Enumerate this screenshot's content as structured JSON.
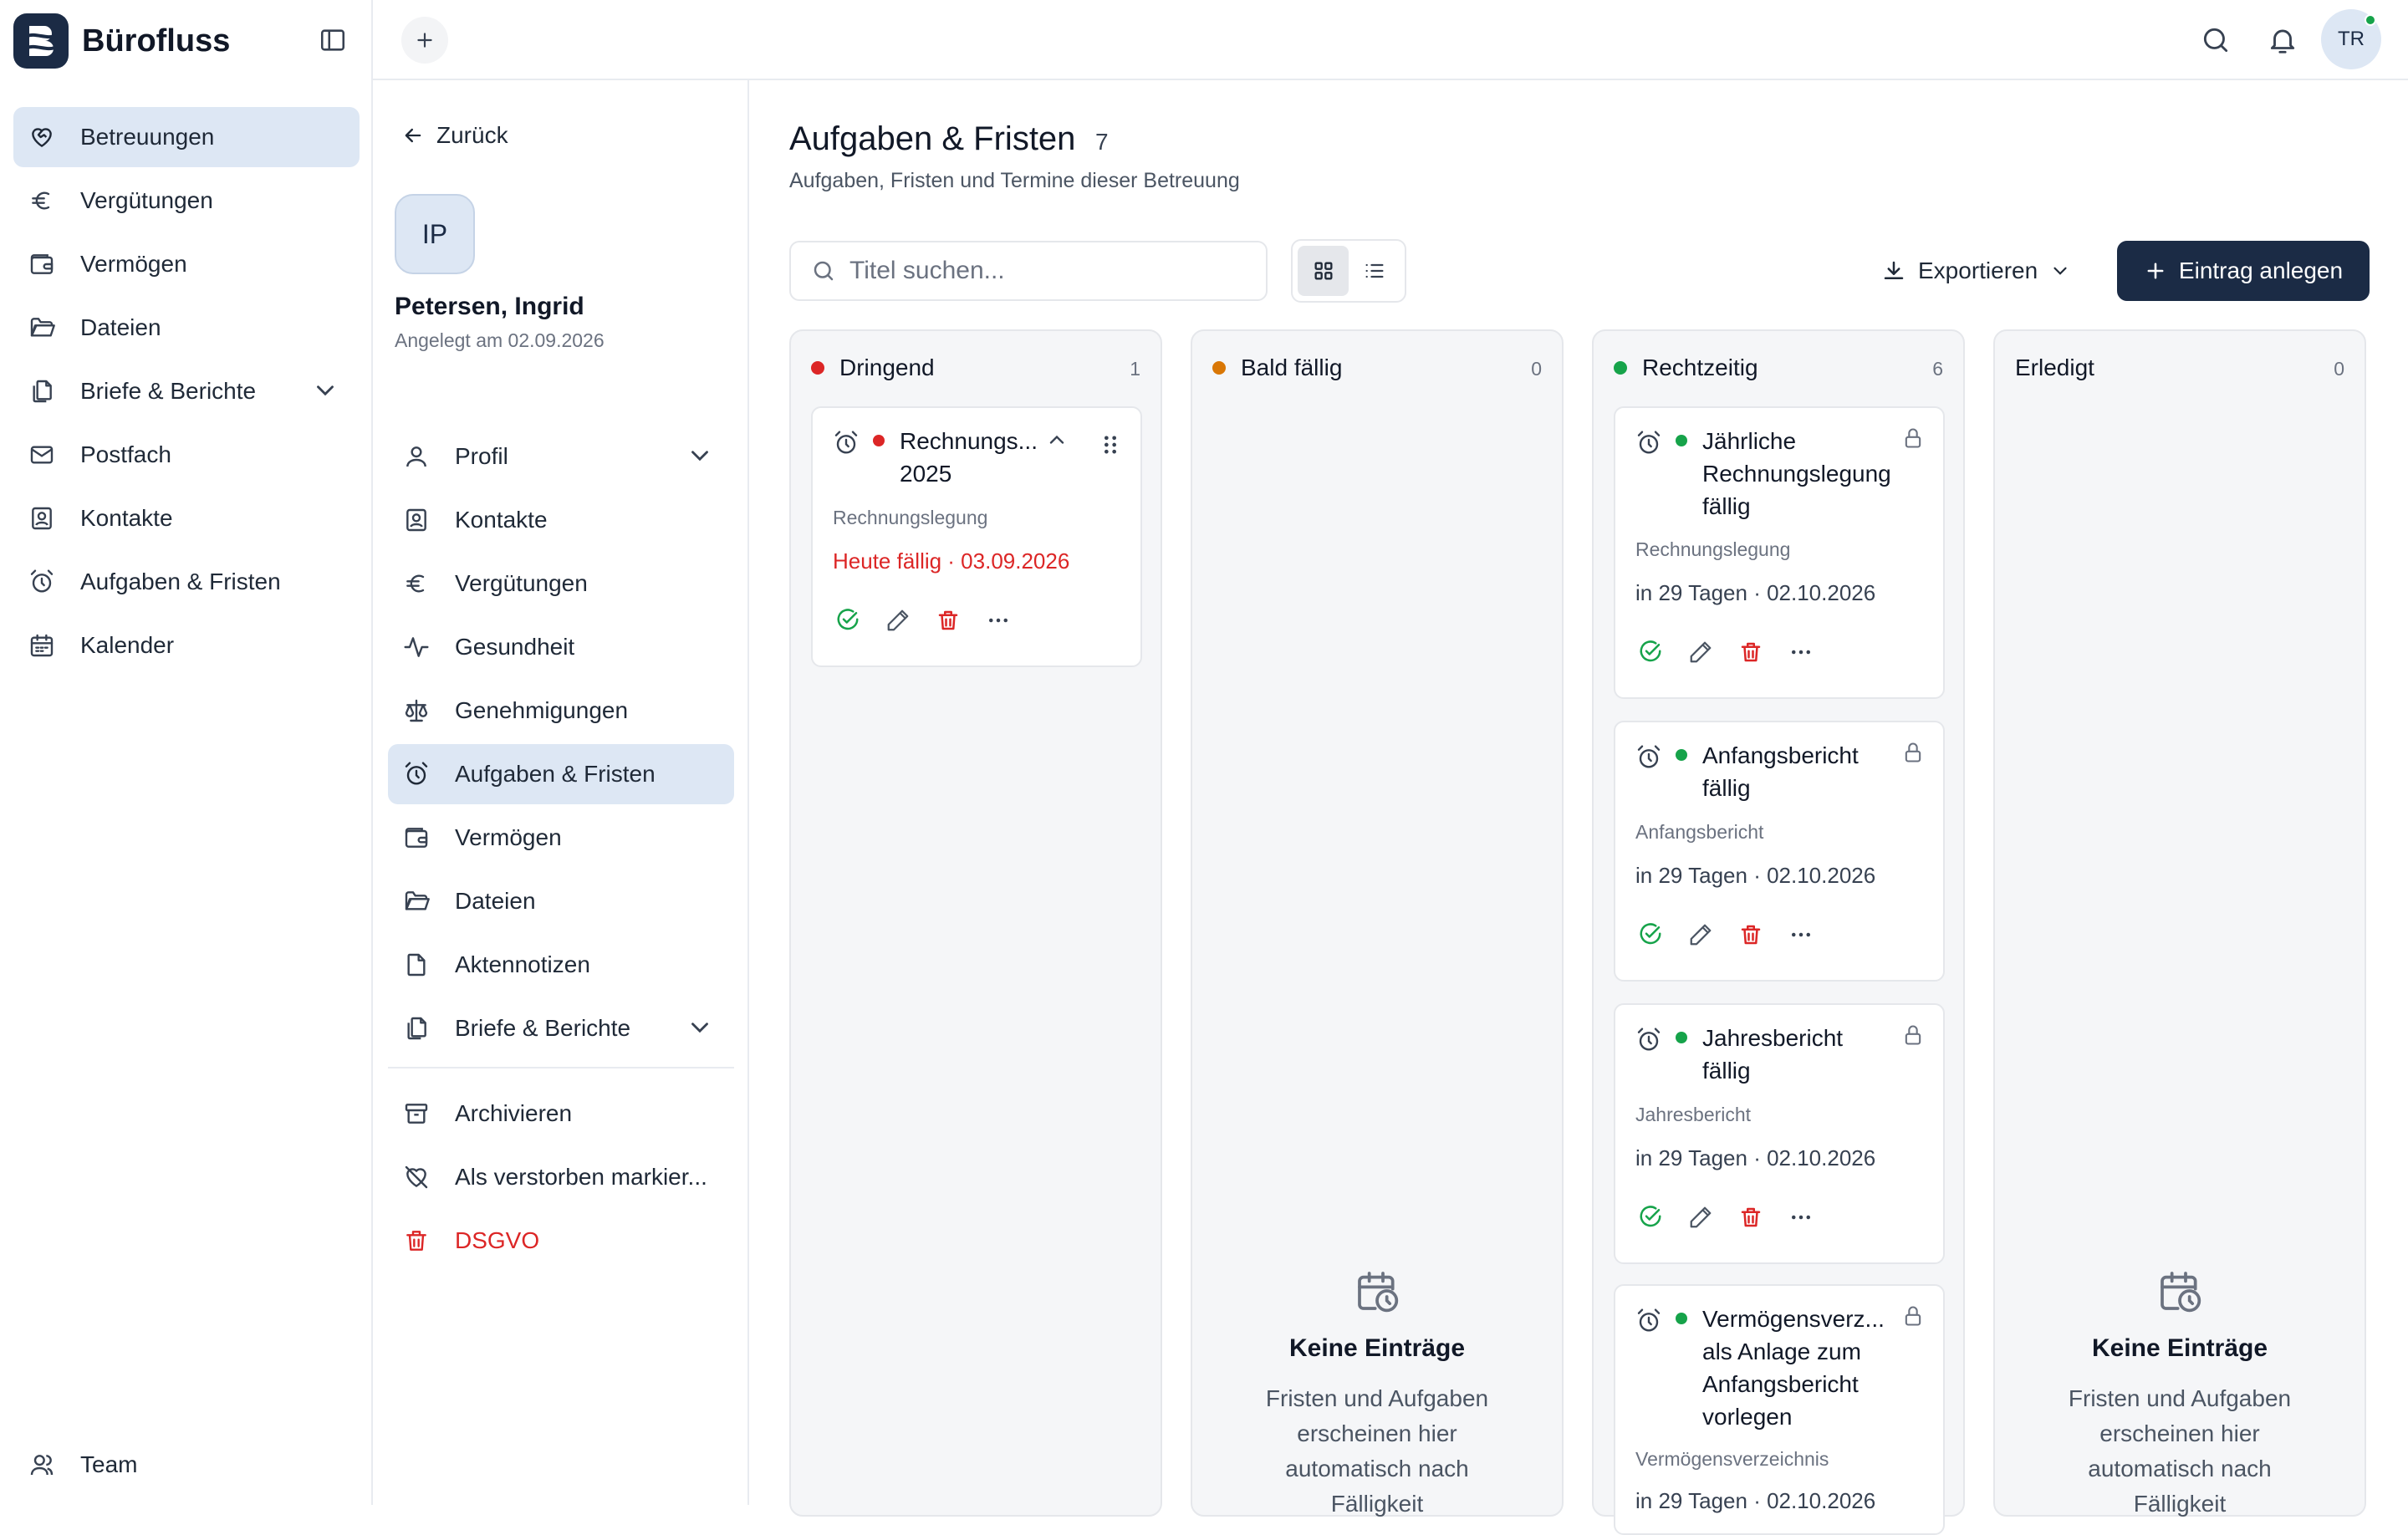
{
  "app": {
    "name": "Bürofluss",
    "nav": [
      {
        "label": "Betreuungen",
        "icon": "heart-handshake-icon",
        "active": true
      },
      {
        "label": "Vergütungen",
        "icon": "euro-icon"
      },
      {
        "label": "Vermögen",
        "icon": "wallet-icon"
      },
      {
        "label": "Dateien",
        "icon": "folder-icon"
      },
      {
        "label": "Briefe & Berichte",
        "icon": "files-icon",
        "expandable": true
      },
      {
        "label": "Postfach",
        "icon": "mail-icon"
      },
      {
        "label": "Kontakte",
        "icon": "contact-icon"
      },
      {
        "label": "Aufgaben & Fristen",
        "icon": "alarm-clock-icon"
      },
      {
        "label": "Kalender",
        "icon": "calendar-icon"
      }
    ],
    "team_label": "Team"
  },
  "topbar": {
    "user_initials": "TR"
  },
  "client": {
    "back_label": "Zurück",
    "initials": "IP",
    "name": "Petersen, Ingrid",
    "created": "Angelegt am 02.09.2026",
    "nav": [
      {
        "label": "Profil",
        "icon": "user-icon",
        "expandable": true
      },
      {
        "label": "Kontakte",
        "icon": "contact-icon"
      },
      {
        "label": "Vergütungen",
        "icon": "euro-icon"
      },
      {
        "label": "Gesundheit",
        "icon": "activity-icon"
      },
      {
        "label": "Genehmigungen",
        "icon": "scale-icon"
      },
      {
        "label": "Aufgaben & Fristen",
        "icon": "alarm-clock-icon",
        "active": true
      },
      {
        "label": "Vermögen",
        "icon": "wallet-icon"
      },
      {
        "label": "Dateien",
        "icon": "folder-icon"
      },
      {
        "label": "Aktennotizen",
        "icon": "file-icon"
      },
      {
        "label": "Briefe & Berichte",
        "icon": "files-icon",
        "expandable": true
      }
    ],
    "actions": [
      {
        "label": "Archivieren",
        "icon": "archive-icon"
      },
      {
        "label": "Als verstorben markier...",
        "icon": "heart-off-icon"
      },
      {
        "label": "DSGVO",
        "icon": "trash-icon",
        "danger": true
      }
    ]
  },
  "page": {
    "title": "Aufgaben & Fristen",
    "count": "7",
    "subtitle": "Aufgaben, Fristen und Termine dieser Betreuung",
    "search_placeholder": "Titel suchen...",
    "view_mode": "board",
    "export_label": "Exportieren",
    "create_label": "Eintrag anlegen"
  },
  "colors": {
    "urgent": "#dc2626",
    "soon": "#d97706",
    "ontime": "#16a34a",
    "brand": "#1b2b45",
    "active_bg": "#dde7f4"
  },
  "board": {
    "columns": [
      {
        "name": "Dringend",
        "count": "1",
        "dot": "#dc2626",
        "cards": [
          {
            "title": "Rechnungs... 2025",
            "category": "Rechnungslegung",
            "due": "Heute fällig · 03.09.2026",
            "due_urgent": true,
            "dot": "#dc2626"
          }
        ]
      },
      {
        "name": "Bald fällig",
        "count": "0",
        "dot": "#d97706",
        "empty_title": "Keine Einträge",
        "empty_text": "Fristen und Aufgaben erscheinen hier automatisch nach Fälligkeit"
      },
      {
        "name": "Rechtzeitig",
        "count": "6",
        "dot": "#16a34a",
        "cards": [
          {
            "title": "Jährliche Rechnungslegung fällig",
            "category": "Rechnungslegung",
            "due": "in 29 Tagen · 02.10.2026",
            "dot": "#16a34a",
            "locked": true
          },
          {
            "title": "Anfangsbericht fällig",
            "category": "Anfangsbericht",
            "due": "in 29 Tagen · 02.10.2026",
            "dot": "#16a34a",
            "locked": true
          },
          {
            "title": "Jahresbericht fällig",
            "category": "Jahresbericht",
            "due": "in 29 Tagen · 02.10.2026",
            "dot": "#16a34a",
            "locked": true
          },
          {
            "title": "Vermögensverz... als Anlage zum Anfangsbericht vorlegen",
            "category": "Vermögensverzeichnis",
            "due": "in 29 Tagen · 02.10.2026",
            "dot": "#16a34a",
            "locked": true
          }
        ]
      },
      {
        "name": "Erledigt",
        "count": "0",
        "empty_title": "Keine Einträge",
        "empty_text": "Fristen und Aufgaben erscheinen hier automatisch nach Fälligkeit"
      }
    ]
  }
}
